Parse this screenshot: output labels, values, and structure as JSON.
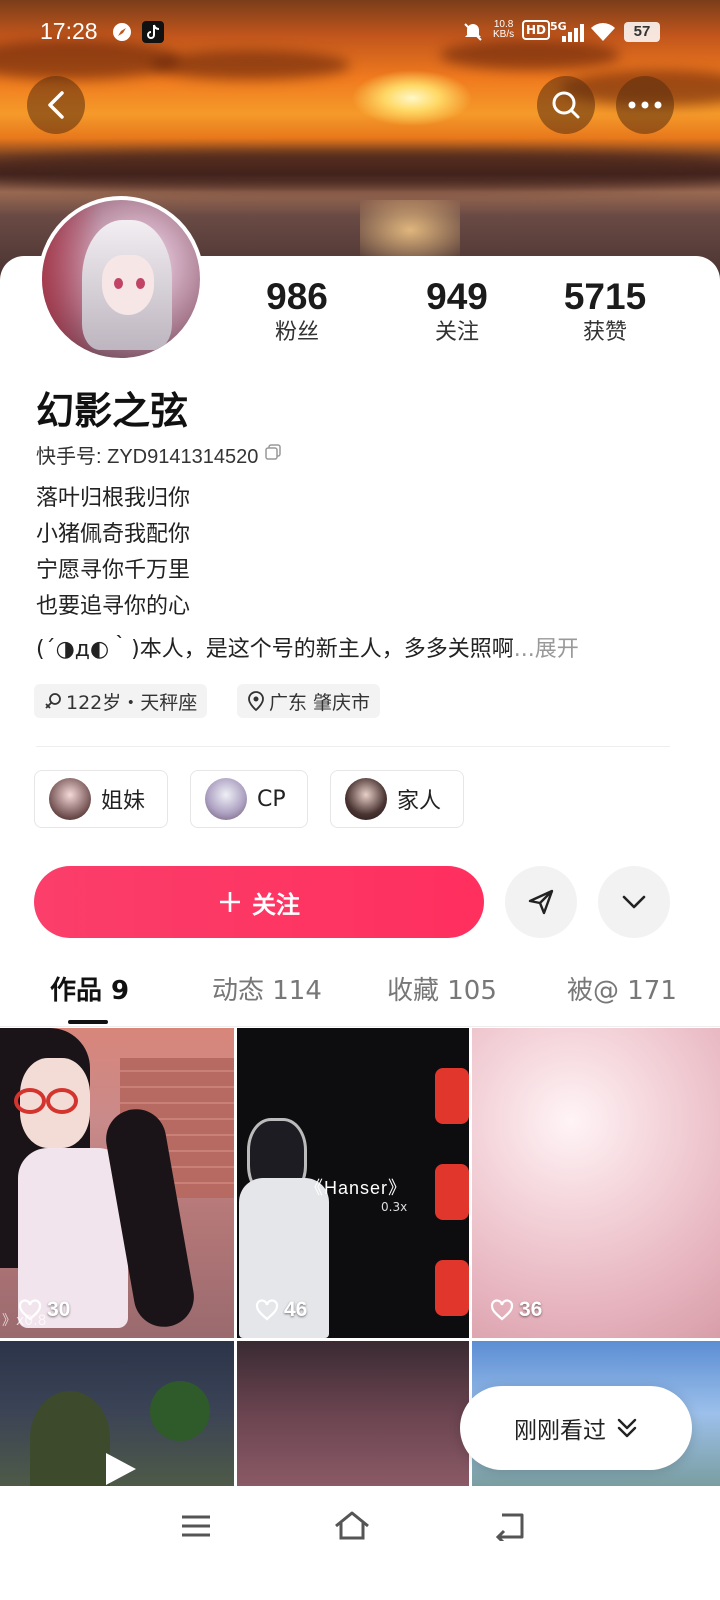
{
  "status_bar": {
    "time": "17:28",
    "speed_value": "10.8",
    "speed_unit": "KB/s",
    "hd": "HD",
    "network": "5G",
    "battery": "57"
  },
  "header": {
    "back_icon": "chevron-left-icon",
    "search_icon": "search-icon",
    "more_icon": "more-horizontal-icon"
  },
  "profile": {
    "name": "幻影之弦",
    "id_label": "快手号: ZYD9141314520",
    "bio_lines": [
      "落叶归根我归你",
      "小猪佩奇我配你",
      "宁愿寻你千万里",
      "也要追寻你的心"
    ],
    "bio_last": "(´◑д◐｀)本人，是这个号的新主人，多多关照啊",
    "bio_more": "...展开",
    "tags": [
      "122岁・天秤座",
      "广东 肇庆市"
    ]
  },
  "stats": [
    {
      "value": "986",
      "label": "粉丝"
    },
    {
      "value": "949",
      "label": "关注"
    },
    {
      "value": "5715",
      "label": "获赞"
    }
  ],
  "groups": [
    {
      "label": "姐妹"
    },
    {
      "label": "CP"
    },
    {
      "label": "家人"
    }
  ],
  "actions": {
    "follow_label": "关注",
    "accent": "#fb3e6a"
  },
  "tabs": [
    {
      "label": "作品 9"
    },
    {
      "label": "动态 114"
    },
    {
      "label": "收藏 105"
    },
    {
      "label": "被@ 171"
    }
  ],
  "grid": [
    {
      "likes": "30",
      "badge": "》x0.8"
    },
    {
      "likes": "46",
      "text": "《Hanser》",
      "speed": "0.3x"
    },
    {
      "likes": "36"
    }
  ],
  "recent_button": "刚刚看过"
}
